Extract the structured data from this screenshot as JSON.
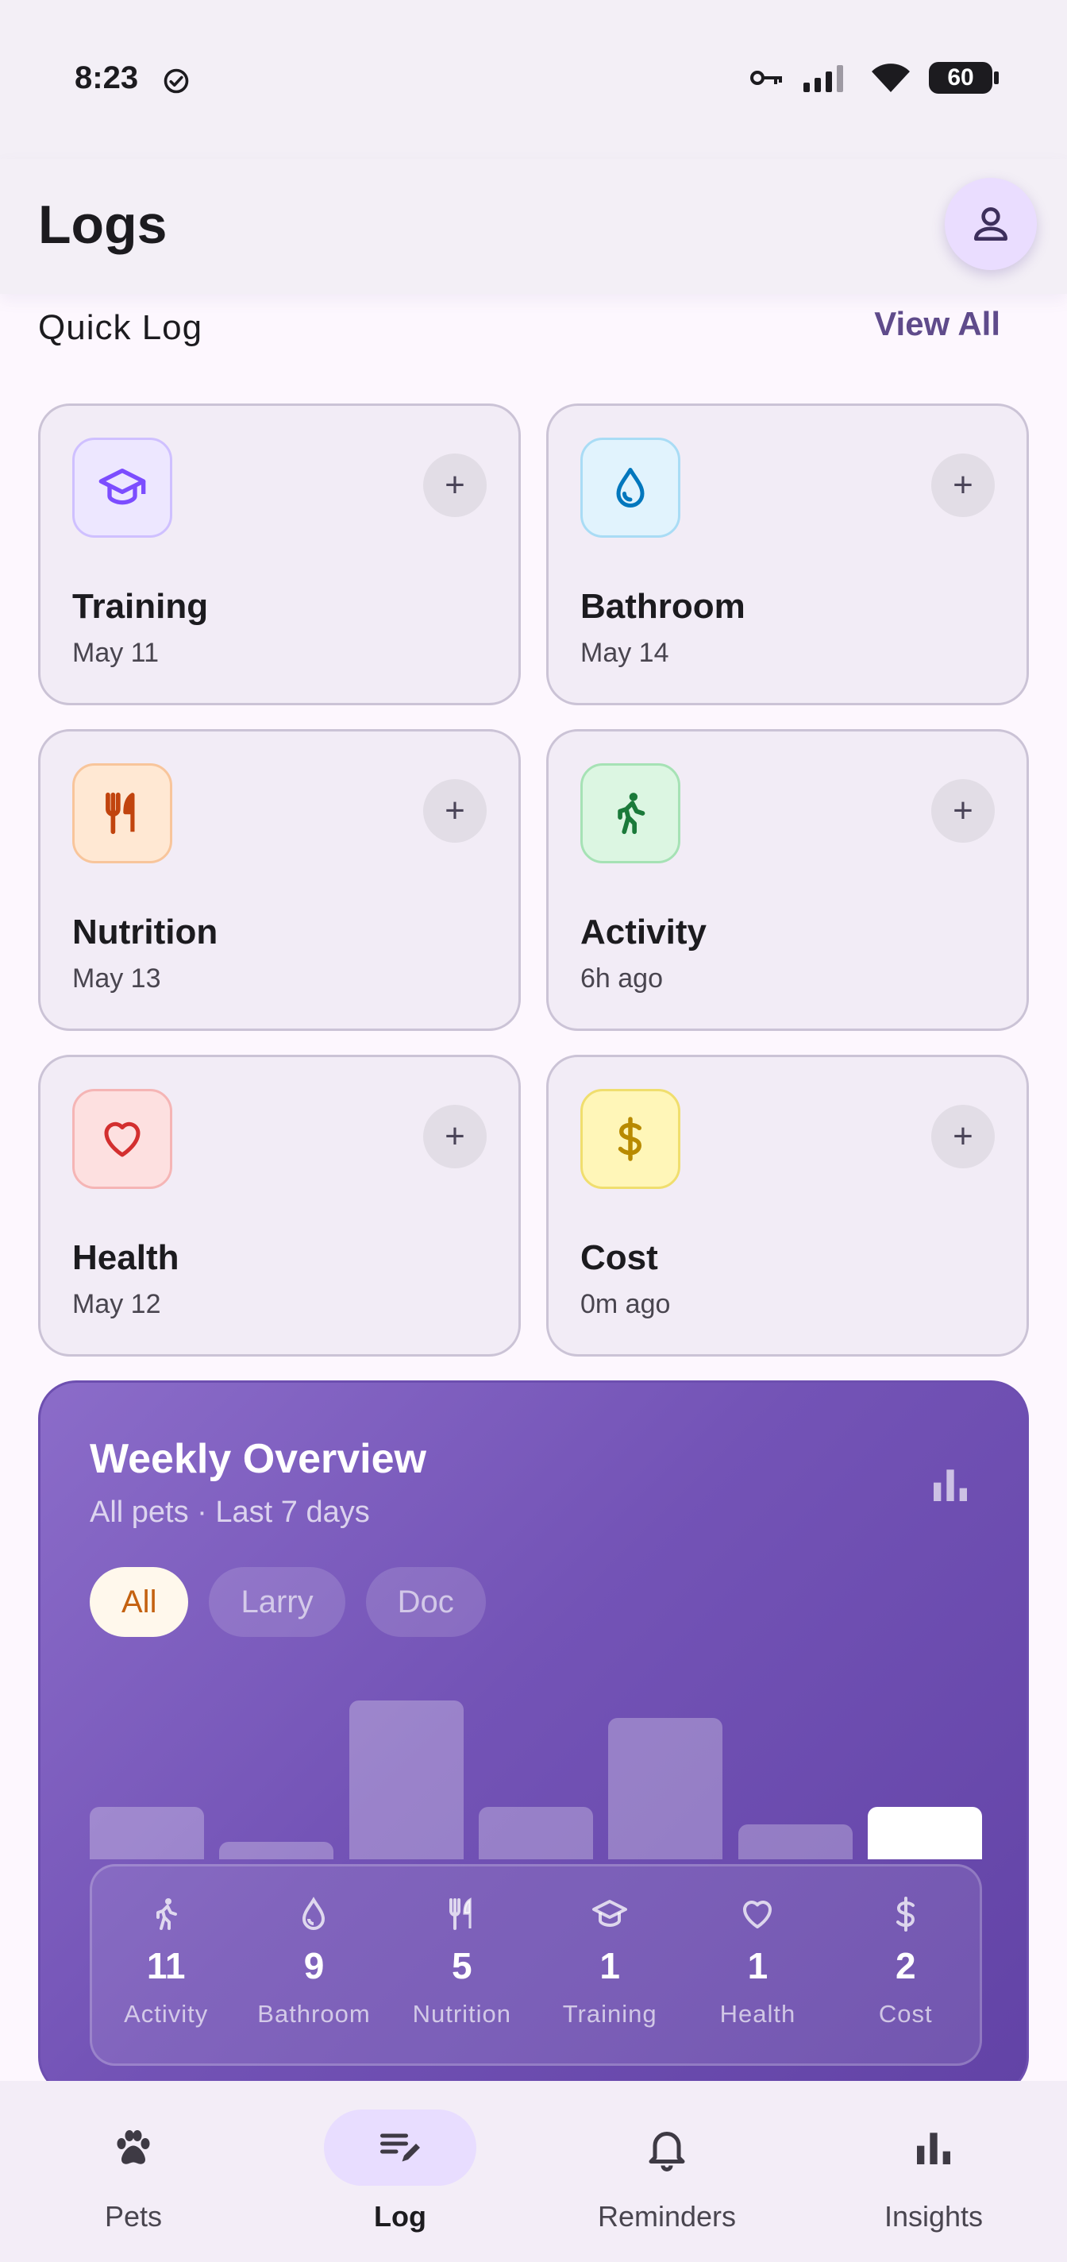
{
  "status_bar": {
    "time": "8:23",
    "battery": "60"
  },
  "header": {
    "title": "Logs"
  },
  "quick_log": {
    "title": "Quick Log",
    "view_all": "View All",
    "cards": [
      {
        "title": "Training",
        "subtitle": "May 11",
        "icon": "graduation-cap-icon",
        "color": "#7c4dff"
      },
      {
        "title": "Bathroom",
        "subtitle": "May 14",
        "icon": "water-drop-icon",
        "color": "#0277bd"
      },
      {
        "title": "Nutrition",
        "subtitle": "May 13",
        "icon": "fork-knife-icon",
        "color": "#c1440e"
      },
      {
        "title": "Activity",
        "subtitle": "6h ago",
        "icon": "walking-person-icon",
        "color": "#1b7a3a"
      },
      {
        "title": "Health",
        "subtitle": "May 12",
        "icon": "heart-icon",
        "color": "#d32f2f"
      },
      {
        "title": "Cost",
        "subtitle": "0m ago",
        "icon": "dollar-icon",
        "color": "#b88a00"
      }
    ]
  },
  "overview": {
    "title": "Weekly Overview",
    "subtitle": "All pets · Last 7 days",
    "chips": [
      {
        "label": "All",
        "active": true
      },
      {
        "label": "Larry",
        "active": false
      },
      {
        "label": "Doc",
        "active": false
      }
    ],
    "bar_levels": [
      0.33,
      0.11,
      1.0,
      0.33,
      0.89,
      0.22,
      0.33
    ],
    "current_index": 6,
    "stats": [
      {
        "value": "11",
        "label": "Activity",
        "icon": "walking-person-icon"
      },
      {
        "value": "9",
        "label": "Bathroom",
        "icon": "water-drop-icon"
      },
      {
        "value": "5",
        "label": "Nutrition",
        "icon": "fork-knife-icon"
      },
      {
        "value": "1",
        "label": "Training",
        "icon": "graduation-cap-icon"
      },
      {
        "value": "1",
        "label": "Health",
        "icon": "heart-icon"
      },
      {
        "value": "2",
        "label": "Cost",
        "icon": "dollar-icon"
      }
    ]
  },
  "nav": [
    {
      "label": "Pets",
      "icon": "paw-icon",
      "active": false
    },
    {
      "label": "Log",
      "icon": "edit-list-icon",
      "active": true
    },
    {
      "label": "Reminders",
      "icon": "bell-icon",
      "active": false
    },
    {
      "label": "Insights",
      "icon": "bar-chart-icon",
      "active": false
    }
  ]
}
